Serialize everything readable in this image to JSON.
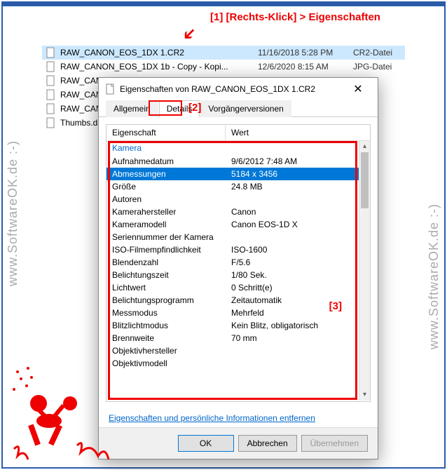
{
  "watermark": "www.SoftwareOK.de :-)",
  "annotation": {
    "top": "[1]   [Rechts-Klick] > Eigenschaften",
    "num2": "[2]",
    "num3": "[3]"
  },
  "files": [
    {
      "name": "RAW_CANON_EOS_1DX 1.CR2",
      "date": "11/16/2018 5:28 PM",
      "type": "CR2-Datei",
      "selected": true
    },
    {
      "name": "RAW_CANON_EOS_1DX 1b - Copy - Kopi...",
      "date": "12/6/2020 8:15 AM",
      "type": "JPG-Datei",
      "selected": false
    },
    {
      "name": "RAW_CANO...",
      "date": "",
      "type": "",
      "selected": false
    },
    {
      "name": "RAW_CANO...",
      "date": "",
      "type": "",
      "selected": false
    },
    {
      "name": "RAW_CANO...",
      "date": "",
      "type": "",
      "selected": false
    },
    {
      "name": "Thumbs.db",
      "date": "",
      "type": "",
      "selected": false
    }
  ],
  "dialog": {
    "title": "Eigenschaften von RAW_CANON_EOS_1DX 1.CR2",
    "tabs": {
      "general": "Allgemein",
      "details": "Details",
      "versions": "Vorgängerversionen"
    },
    "header": {
      "prop": "Eigenschaft",
      "val": "Wert"
    },
    "section": "Kamera",
    "props": [
      {
        "name": "Aufnahmedatum",
        "value": "9/6/2012 7:48 AM"
      },
      {
        "name": "Abmessungen",
        "value": "5184 x 3456",
        "selected": true
      },
      {
        "name": "Größe",
        "value": "24.8 MB"
      },
      {
        "name": "Autoren",
        "value": ""
      },
      {
        "name": "Kamerahersteller",
        "value": "Canon"
      },
      {
        "name": "Kameramodell",
        "value": "Canon EOS-1D X"
      },
      {
        "name": "Seriennummer der Kamera",
        "value": ""
      },
      {
        "name": "ISO-Filmempfindlichkeit",
        "value": "ISO-1600"
      },
      {
        "name": "Blendenzahl",
        "value": "F/5.6"
      },
      {
        "name": "Belichtungszeit",
        "value": "1/80 Sek."
      },
      {
        "name": "Lichtwert",
        "value": "0 Schritt(e)"
      },
      {
        "name": "Belichtungsprogramm",
        "value": "Zeitautomatik"
      },
      {
        "name": "Messmodus",
        "value": "Mehrfeld"
      },
      {
        "name": "Blitzlichtmodus",
        "value": "Kein Blitz, obligatorisch"
      },
      {
        "name": "Brennweite",
        "value": "70 mm"
      },
      {
        "name": "Objektivhersteller",
        "value": ""
      },
      {
        "name": "Objektivmodell",
        "value": ""
      }
    ],
    "link": "Eigenschaften und persönliche Informationen entfernen",
    "ok": "OK",
    "cancel": "Abbrechen",
    "apply": "Übernehmen"
  }
}
